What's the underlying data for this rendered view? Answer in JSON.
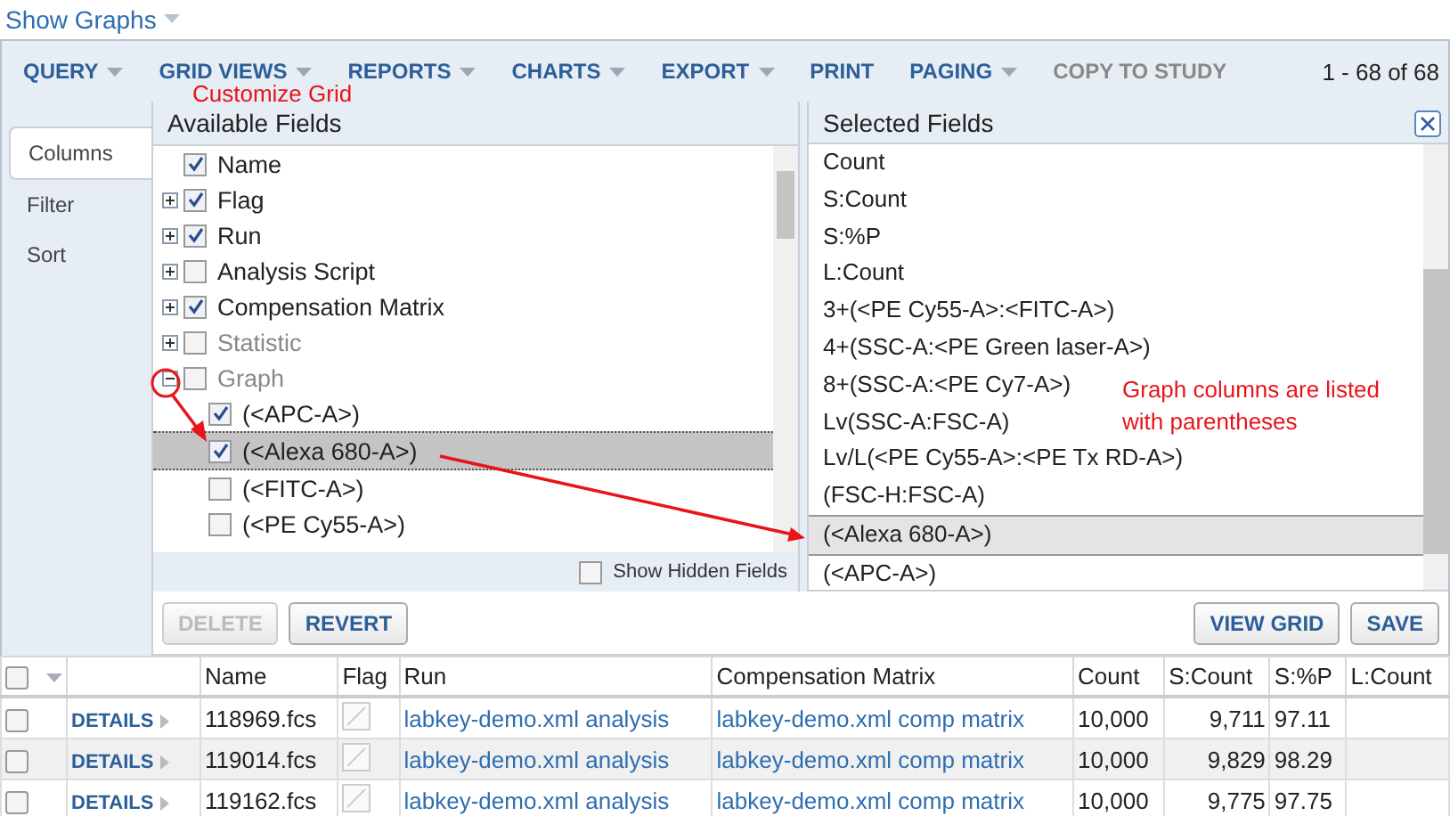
{
  "header": {
    "title": "Show Graphs"
  },
  "toolbar": {
    "menus": [
      {
        "label": "QUERY",
        "dropdown": true,
        "disabled": false
      },
      {
        "label": "GRID VIEWS",
        "dropdown": true,
        "disabled": false
      },
      {
        "label": "REPORTS",
        "dropdown": true,
        "disabled": false
      },
      {
        "label": "CHARTS",
        "dropdown": true,
        "disabled": false
      },
      {
        "label": "EXPORT",
        "dropdown": true,
        "disabled": false
      },
      {
        "label": "PRINT",
        "dropdown": false,
        "disabled": false
      },
      {
        "label": "PAGING",
        "dropdown": true,
        "disabled": false
      },
      {
        "label": "COPY TO STUDY",
        "dropdown": false,
        "disabled": true
      }
    ],
    "paging": "1 - 68 of 68"
  },
  "annotations": {
    "customize": "Customize Grid",
    "note": "Graph columns are listed with parentheses"
  },
  "side_tabs": [
    {
      "label": "Columns",
      "selected": true
    },
    {
      "label": "Filter",
      "selected": false
    },
    {
      "label": "Sort",
      "selected": false
    }
  ],
  "available": {
    "title": "Available Fields",
    "items": [
      {
        "label": "Name",
        "checked": true,
        "expandable": false,
        "greyed": false
      },
      {
        "label": "Flag",
        "checked": true,
        "expandable": true,
        "expanded": false,
        "greyed": false
      },
      {
        "label": "Run",
        "checked": true,
        "expandable": true,
        "expanded": false,
        "greyed": false
      },
      {
        "label": "Analysis Script",
        "checked": false,
        "expandable": true,
        "expanded": false,
        "greyed": false
      },
      {
        "label": "Compensation Matrix",
        "checked": true,
        "expandable": true,
        "expanded": false,
        "greyed": false
      },
      {
        "label": "Statistic",
        "checked": false,
        "expandable": true,
        "expanded": false,
        "greyed": true
      },
      {
        "label": "Graph",
        "checked": false,
        "expandable": true,
        "expanded": true,
        "greyed": true,
        "children": [
          {
            "label": "(<APC-A>)",
            "checked": true,
            "selected": false
          },
          {
            "label": "(<Alexa 680-A>)",
            "checked": true,
            "selected": true
          },
          {
            "label": "(<FITC-A>)",
            "checked": false,
            "selected": false
          },
          {
            "label": "(<PE Cy55-A>)",
            "checked": false,
            "selected": false
          }
        ]
      }
    ],
    "show_hidden": {
      "label": "Show Hidden Fields",
      "checked": false
    }
  },
  "selected_fields": {
    "title": "Selected Fields",
    "items": [
      {
        "label": "Count",
        "selected": false
      },
      {
        "label": "S:Count",
        "selected": false
      },
      {
        "label": "S:%P",
        "selected": false
      },
      {
        "label": "L:Count",
        "selected": false
      },
      {
        "label": "3+(<PE Cy55-A>:<FITC-A>)",
        "selected": false
      },
      {
        "label": "4+(SSC-A:<PE Green laser-A>)",
        "selected": false
      },
      {
        "label": "8+(SSC-A:<PE Cy7-A>)",
        "selected": false
      },
      {
        "label": "Lv(SSC-A:FSC-A)",
        "selected": false
      },
      {
        "label": "Lv/L(<PE Cy55-A>:<PE Tx RD-A>)",
        "selected": false
      },
      {
        "label": "(FSC-H:FSC-A)",
        "selected": false
      },
      {
        "label": "(<Alexa 680-A>)",
        "selected": true
      },
      {
        "label": "(<APC-A>)",
        "selected": false
      }
    ]
  },
  "buttons": {
    "left": [
      {
        "label": "DELETE",
        "disabled": true
      },
      {
        "label": "REVERT",
        "disabled": false
      }
    ],
    "right": [
      {
        "label": "VIEW GRID",
        "disabled": false
      },
      {
        "label": "SAVE",
        "disabled": false
      }
    ]
  },
  "table": {
    "select_all_checked": false,
    "columns": [
      "Name",
      "Flag",
      "Run",
      "Compensation Matrix",
      "Count",
      "S:Count",
      "S:%P",
      "L:Count"
    ],
    "rows": [
      {
        "checked": false,
        "details": "DETAILS",
        "name": "118969.fcs",
        "run": "labkey-demo.xml analysis",
        "comp": "labkey-demo.xml comp matrix",
        "count": "10,000",
        "s_count": "9,711",
        "s_p": "97.11"
      },
      {
        "checked": false,
        "details": "DETAILS",
        "name": "119014.fcs",
        "run": "labkey-demo.xml analysis",
        "comp": "labkey-demo.xml comp matrix",
        "count": "10,000",
        "s_count": "9,829",
        "s_p": "98.29"
      },
      {
        "checked": false,
        "details": "DETAILS",
        "name": "119162.fcs",
        "run": "labkey-demo.xml analysis",
        "comp": "labkey-demo.xml comp matrix",
        "count": "10,000",
        "s_count": "9,775",
        "s_p": "97.75"
      }
    ]
  }
}
